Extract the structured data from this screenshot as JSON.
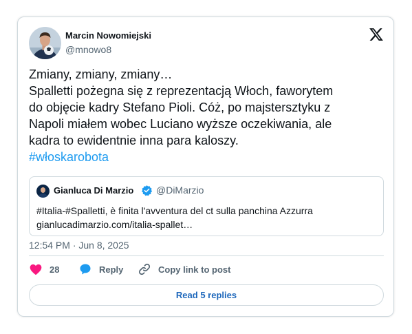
{
  "author": {
    "name": "Marcin Nowomiejski",
    "handle": "@mnowo8"
  },
  "tweet": {
    "lines": [
      "Zmiany, zmiany, zmiany…",
      "Spalletti pożegna się z reprezentacją Włoch, faworytem",
      "do objęcie kadry Stefano Pioli. Cóż, po majstersztyku z",
      "Napoli miałem wobec Luciano wyższe oczekiwania, ale",
      "kadra to ewidentnie inna para kaloszy."
    ],
    "hashtag": "#włoskarobota"
  },
  "quote": {
    "name": "Gianluca Di Marzio",
    "handle": "@DiMarzio",
    "text_line1": "#Italia-#Spalletti, è finita l'avventura del ct sulla panchina Azzurra",
    "text_line2": "gianlucadimarzio.com/italia-spallet…"
  },
  "timestamp": "12:54 PM · Jun 8, 2025",
  "actions": {
    "like_count": "28",
    "reply_label": "Reply",
    "copy_label": "Copy link to post"
  },
  "read_replies_label": "Read 5 replies",
  "icons": {
    "platform": "x-logo-icon",
    "like": "heart-icon",
    "reply": "speech-bubble-icon",
    "copy": "link-icon",
    "verified": "verified-badge-icon"
  },
  "colors": {
    "link_blue": "#1d9bf0",
    "like_pink": "#f91880",
    "muted_gray": "#536471",
    "border": "#cfd9de"
  }
}
